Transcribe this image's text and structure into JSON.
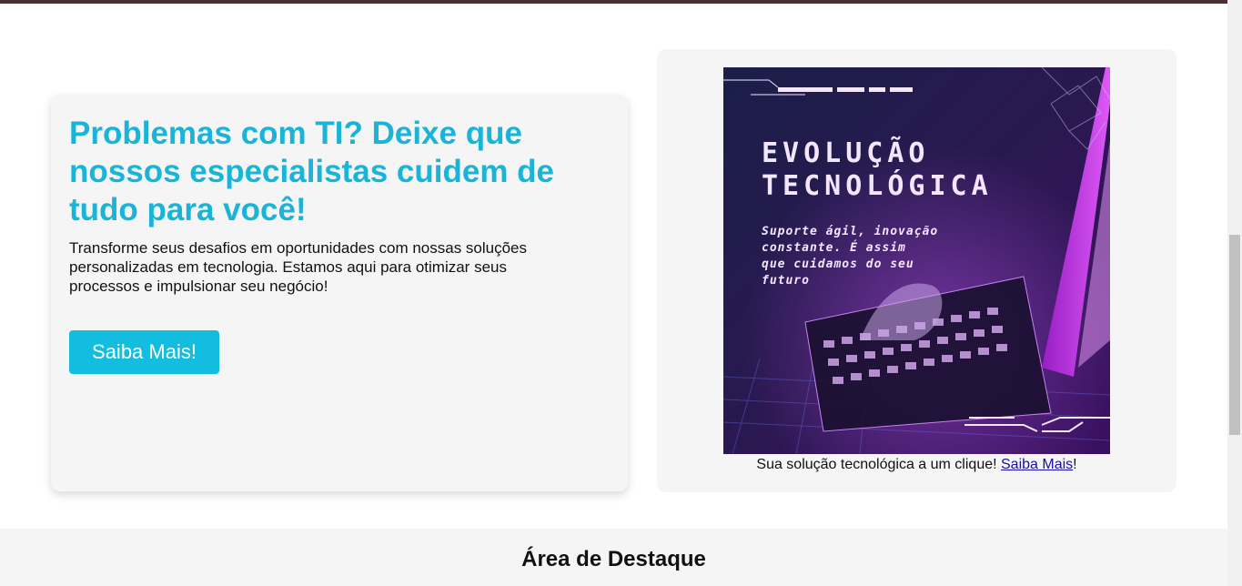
{
  "hero": {
    "title": "Problemas com TI? Deixe que nossos especialistas cuidem de tudo para você!",
    "description": "Transforme seus desafios em oportunidades com nossas soluções personalizadas em tecnologia. Estamos aqui para otimizar seus processos e impulsionar seu negócio!",
    "button_label": "Saiba Mais!"
  },
  "promo": {
    "title_line1": "EVOLUÇÃO",
    "title_line2": "TECNOLÓGICA",
    "sub_line1": "Suporte ágil, inovação",
    "sub_line2": "constante. É assim",
    "sub_line3": "que cuidamos do seu",
    "sub_line4": "futuro"
  },
  "caption": {
    "text": "Sua solução tecnológica a um clique! ",
    "link_label": "Saiba Mais",
    "suffix": "!"
  },
  "highlight": {
    "title": "Área de Destaque"
  },
  "colors": {
    "accent": "#12bde0",
    "title": "#1ab4d8",
    "link": "#1a0dab"
  }
}
